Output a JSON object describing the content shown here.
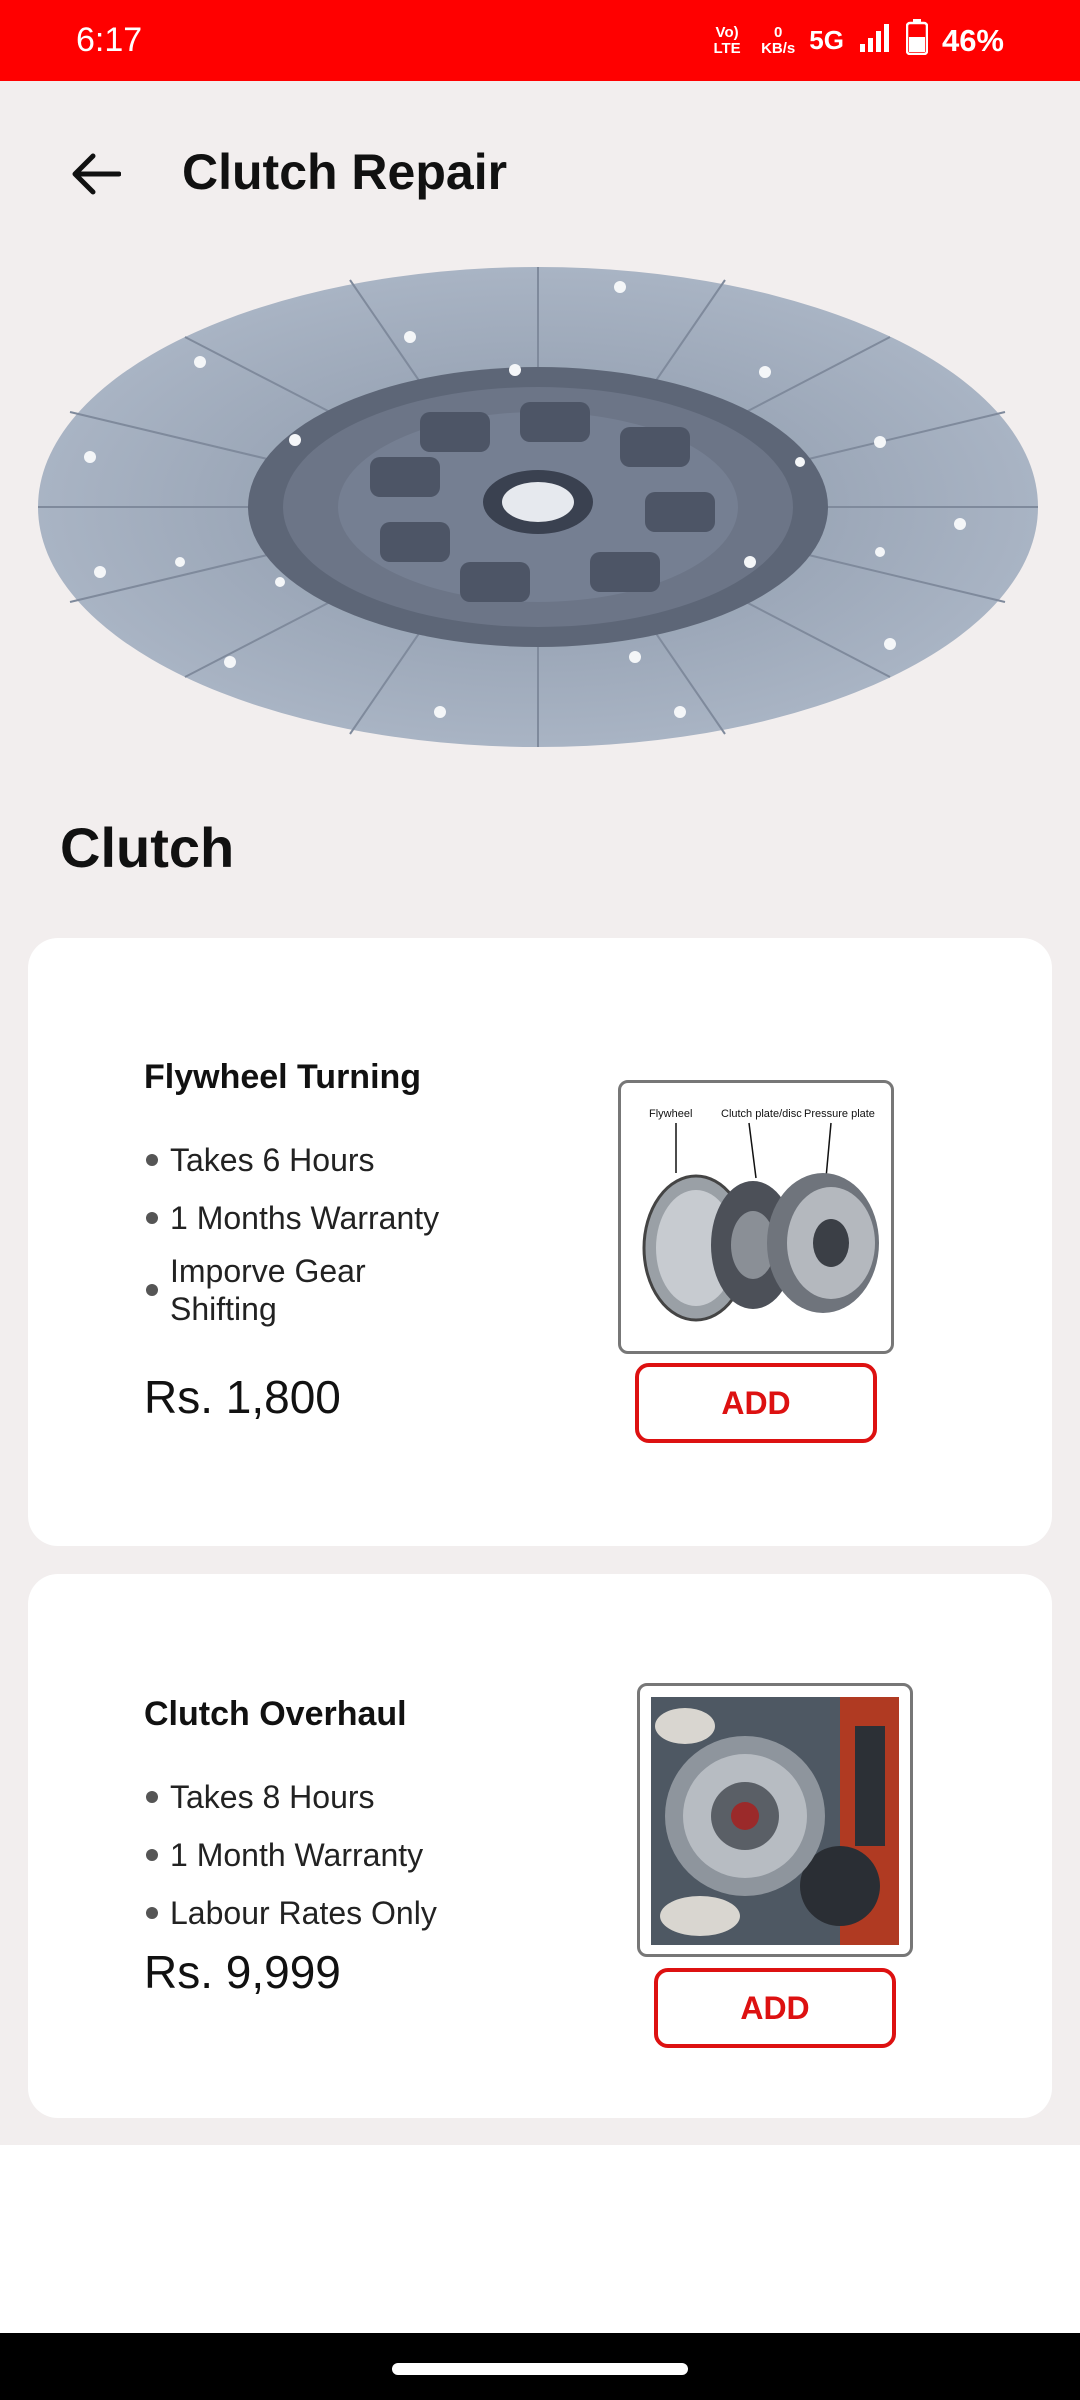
{
  "status_bar": {
    "time": "6:17",
    "volte": "Vo) LTE",
    "data_rate_value": "0",
    "data_rate_unit": "KB/s",
    "network": "5G",
    "battery": "46%"
  },
  "header": {
    "title": "Clutch Repair"
  },
  "section": {
    "title": "Clutch"
  },
  "services": [
    {
      "name": "Flywheel Turning",
      "features": [
        "Takes 6 Hours",
        "1 Months Warranty",
        "Imporve Gear Shifting"
      ],
      "price": "Rs. 1,800",
      "add_label": "ADD",
      "image_labels": [
        "Flywheel",
        "Clutch plate/disc",
        "Pressure plate"
      ]
    },
    {
      "name": "Clutch Overhaul",
      "features": [
        "Takes 8 Hours",
        "1 Month Warranty",
        "Labour Rates Only"
      ],
      "price": "Rs. 9,999",
      "add_label": "ADD"
    }
  ],
  "colors": {
    "status_bar": "#ff0000",
    "accent": "#dd1111",
    "background": "#f2eeee",
    "card": "#ffffff"
  }
}
